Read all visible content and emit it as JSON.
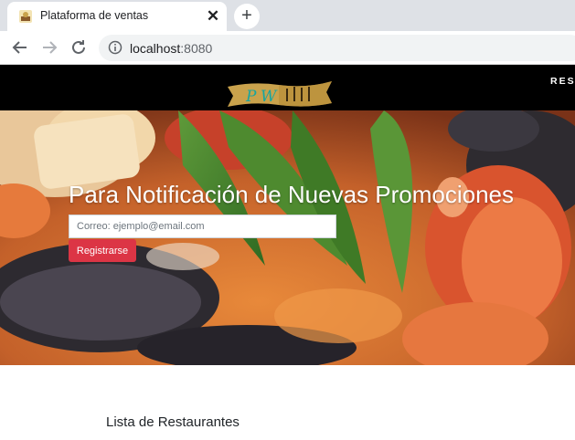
{
  "browser": {
    "tab_title": "Plataforma de ventas",
    "url_host": "localhost",
    "url_port": ":8080",
    "icons": [
      "favicon-icon",
      "close-icon",
      "new-tab-icon",
      "back-icon",
      "forward-icon",
      "reload-icon",
      "info-icon"
    ]
  },
  "navbar": {
    "logo_text": "P W",
    "link_label": "RES"
  },
  "hero": {
    "title": "Para Notificación de Nuevas Promociones",
    "email_placeholder": "Correo: ejemplo@email.com",
    "email_value": "",
    "register_label": "Registrarse"
  },
  "main": {
    "section_title": "Lista de Restaurantes"
  },
  "colors": {
    "navbar_bg": "#000000",
    "button_red": "#dc3545",
    "logo_gold": "#c9a24c",
    "logo_teal": "#17a5a0"
  }
}
